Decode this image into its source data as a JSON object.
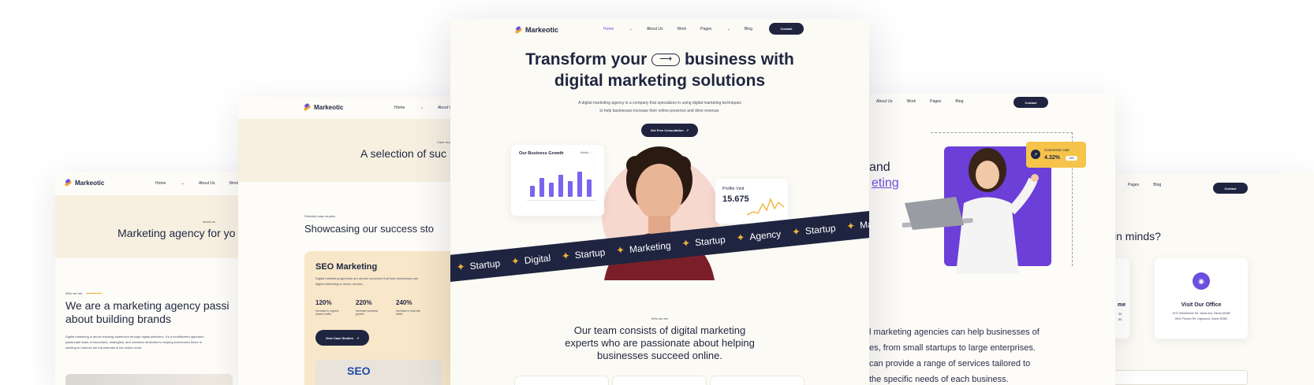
{
  "brand": {
    "name": "Markeotic",
    "accent": "#6b4fe0",
    "dark": "#1f2540",
    "gold": "#f0b43a"
  },
  "nav": {
    "home": "Home",
    "about": "About Us",
    "work": "Work",
    "pages": "Pages",
    "blog": "Blog",
    "contact": "Contact"
  },
  "hero": {
    "title_line1_a": "Transform your",
    "title_line1_b": "business with",
    "title_line2": "digital marketing solutions",
    "desc_line1": "A digital marketing agency is a company that specializes in using digital marketing techniques",
    "desc_line2": "to help businesses increase their online presence and drive revenue.",
    "cta": "Get Free Consultation",
    "growth_card_title": "Our Business Growth",
    "growth_card_select": "Month",
    "growth_bars": [
      0.35,
      0.6,
      0.45,
      0.7,
      0.5,
      0.8,
      0.55
    ],
    "profile_title": "Profile Visit",
    "profile_value": "15.675",
    "ribbon_words": [
      "Startup",
      "Digital",
      "Startup",
      "Marketing",
      "Startup",
      "Agency",
      "Startup",
      "Marketi"
    ]
  },
  "team": {
    "eyebrow": "Who we are",
    "line1": "Our team consists of digital marketing",
    "line2": "experts who are passionate about helping",
    "line3": "businesses succeed online."
  },
  "case_page": {
    "eyebrow": "Case studies",
    "title": "A selection of suc",
    "selected": "Selected case studies",
    "heading": "Showcasing our success sto",
    "card_title": "SEO Marketing",
    "card_desc_line1": "Digital marketing agencies are service providers that help businesses use",
    "card_desc_line2": "digital marketing to reach, nurture,",
    "stats": [
      {
        "value": "120%",
        "label": "Increase in organic search traffic"
      },
      {
        "value": "220%",
        "label": "Increase business growth"
      },
      {
        "value": "240%",
        "label": "Increase in total site traffic"
      }
    ],
    "button": "View Case Studies",
    "seo_badge": "SEO"
  },
  "about_page": {
    "eyebrow": "About us",
    "title": "Marketing agency for yo",
    "who_label": "Who we are",
    "heading_line1": "We are a marketing agency passi",
    "heading_line2": "about building brands",
    "body_line1": "Digital marketing is about reaching audiences through digital platforms. It's a multifaceted approach",
    "body_line2": "passionate team of innovators, strategists, and creatives dedicated to helping businesses thrive in",
    "body_line3": "seeking to harness the full potential of the online world."
  },
  "services_page": {
    "heading_a": "and",
    "heading_b": "eting",
    "conversion_label": "Conversion rate",
    "conversion_value": "4.32%",
    "conversion_badge": "15%",
    "para_line1": "l marketing agencies can help businesses of",
    "para_line2": "es, from small startups to large enterprises.",
    "para_line3": "can provide a range of services tailored to",
    "para_line4": "the specific needs of each business."
  },
  "contact_page": {
    "question": "in minds?",
    "office_title": "Visit Our Office",
    "office_line1": "2972 Westheimer Rd. Santa Ana, Illinois 85486",
    "office_line2": "8502 Preston Rd. Inglewood, Maine 98380",
    "partial_title": "me",
    "partial_line1": "36",
    "partial_line2": "85"
  }
}
